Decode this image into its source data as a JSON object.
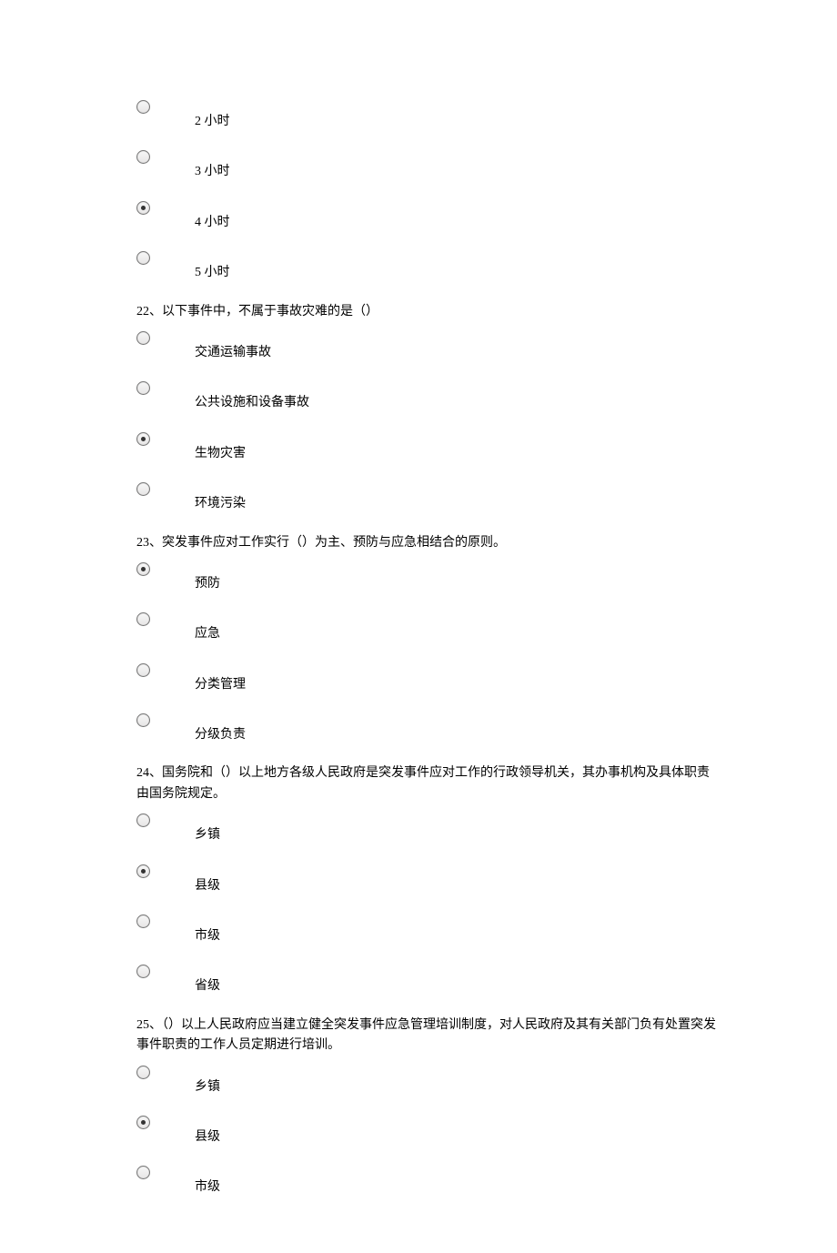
{
  "questions": [
    {
      "id": "q21",
      "text": "",
      "selected": 2,
      "options": [
        "2 小时",
        "3 小时",
        "4 小时",
        "5 小时"
      ]
    },
    {
      "id": "q22",
      "text": "22、以下事件中，不属于事故灾难的是（）",
      "selected": 2,
      "options": [
        "交通运输事故",
        "公共设施和设备事故",
        "生物灾害",
        "环境污染"
      ]
    },
    {
      "id": "q23",
      "text": "23、突发事件应对工作实行（）为主、预防与应急相结合的原则。",
      "selected": 0,
      "options": [
        "预防",
        "应急",
        "分类管理",
        "分级负责"
      ]
    },
    {
      "id": "q24",
      "text": "24、国务院和（）以上地方各级人民政府是突发事件应对工作的行政领导机关，其办事机构及具体职责由国务院规定。",
      "selected": 1,
      "options": [
        "乡镇",
        "县级",
        "市级",
        "省级"
      ]
    },
    {
      "id": "q25",
      "text": "25、（）以上人民政府应当建立健全突发事件应急管理培训制度，对人民政府及其有关部门负有处置突发事件职责的工作人员定期进行培训。",
      "selected": 1,
      "options": [
        "乡镇",
        "县级",
        "市级"
      ]
    }
  ]
}
